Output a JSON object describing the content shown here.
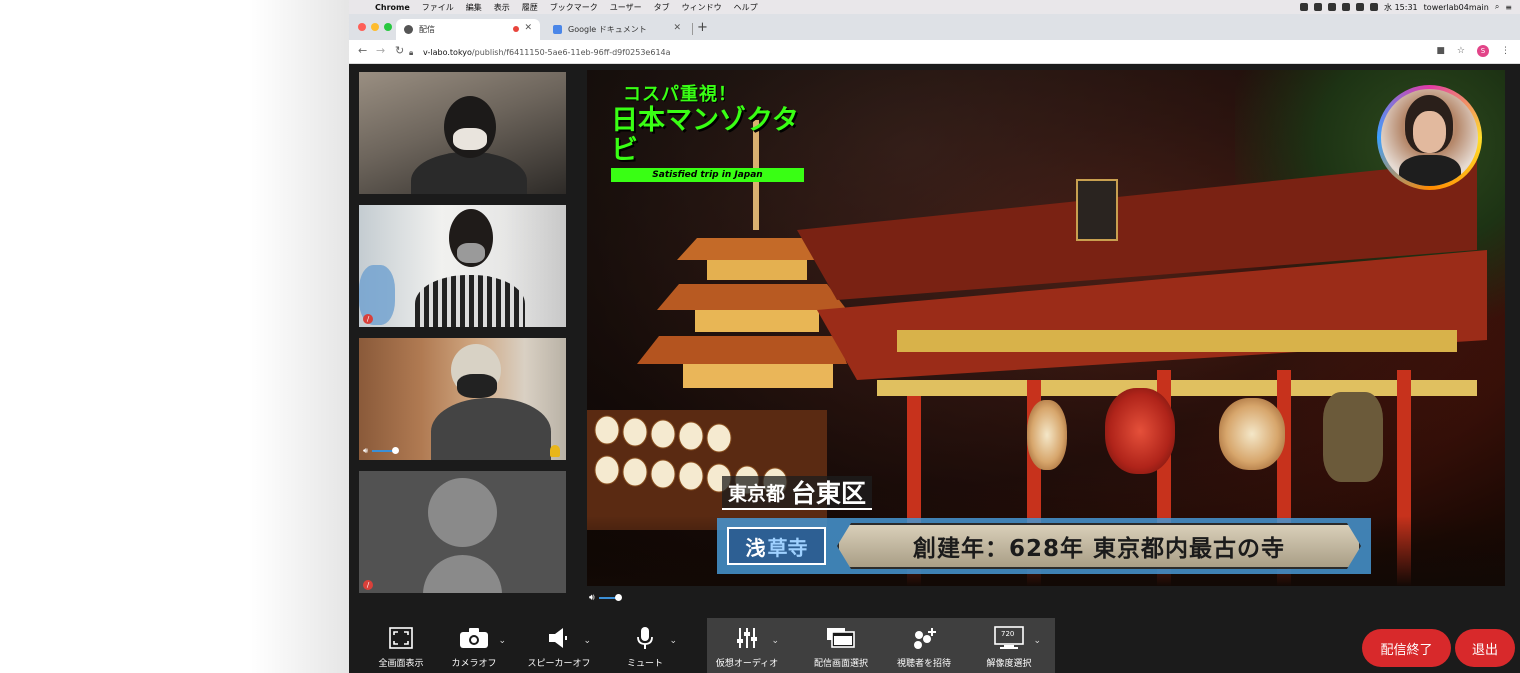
{
  "menubar": {
    "app": "Chrome",
    "items": [
      "ファイル",
      "編集",
      "表示",
      "履歴",
      "ブックマーク",
      "ユーザー",
      "タブ",
      "ウィンドウ",
      "ヘルプ"
    ],
    "clock": "水 15:31",
    "user": "towerlab04main"
  },
  "tabs": [
    {
      "title": "配信",
      "favicon": "globe-icon"
    },
    {
      "title": "Google ドキュメント",
      "favicon": "docs-icon"
    }
  ],
  "address": {
    "host": "v-labo.tokyo",
    "path": "/publish/f6411150-5ae6-11eb-96ff-d9f0253e614a"
  },
  "profile_initial": "S",
  "stage": {
    "logo_line1": "コスパ重視！",
    "logo_line2": "日本マンゾクタビ",
    "logo_line3": "Satisfied trip in Japan",
    "pref": "東京都",
    "ward": "台東区",
    "badge_a": "浅",
    "badge_b": "草寺",
    "fact": "創建年：628年 東京都内最古の寺"
  },
  "controls": [
    {
      "label": "全画面表示",
      "icon": "fullscreen-icon"
    },
    {
      "label": "カメラオフ",
      "icon": "camera-icon"
    },
    {
      "label": "スピーカーオフ",
      "icon": "speaker-icon"
    },
    {
      "label": "ミュート",
      "icon": "mic-icon"
    },
    {
      "label": "仮想オーディオ",
      "icon": "mixer-icon"
    },
    {
      "label": "配信画面選択",
      "icon": "screens-icon"
    },
    {
      "label": "視聴者を招待",
      "icon": "invite-icon"
    },
    {
      "label": "解像度選択",
      "icon": "monitor-icon",
      "badge": "720"
    }
  ],
  "end_button": "配信終了",
  "leave_button": "退出",
  "colors": {
    "accent_green": "#39ff14",
    "end_red": "#d8292b",
    "lower_third_blue": "#4696d2"
  }
}
